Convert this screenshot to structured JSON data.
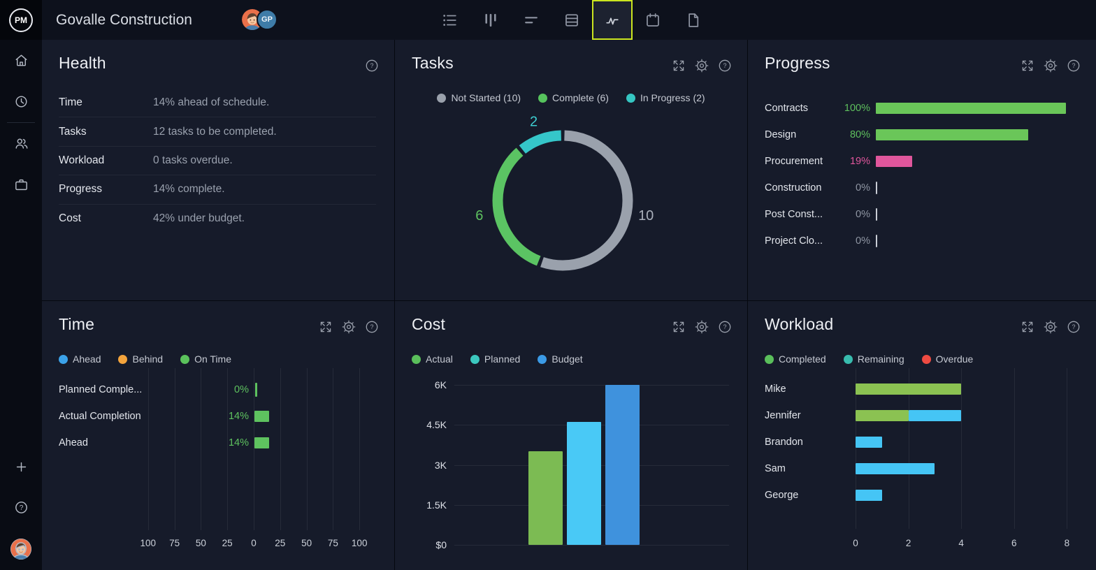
{
  "topbar": {
    "logo": "PM",
    "title": "Govalle Construction",
    "avatar_initials": "GP",
    "active_border_color": "#cbe51f",
    "tools": [
      {
        "name": "list-view",
        "icon": "list-icon",
        "active": false
      },
      {
        "name": "board-view",
        "icon": "board-columns-icon",
        "active": false
      },
      {
        "name": "gantt-view",
        "icon": "gantt-lines-icon",
        "active": false
      },
      {
        "name": "table-view",
        "icon": "table-icon",
        "active": false
      },
      {
        "name": "dashboard-view",
        "icon": "pulse-icon",
        "active": true
      },
      {
        "name": "calendar-view",
        "icon": "calendar-icon",
        "active": false
      },
      {
        "name": "docs-view",
        "icon": "document-icon",
        "active": false
      }
    ]
  },
  "sidebar": {
    "items": [
      "home",
      "recent",
      "team",
      "portfolio"
    ],
    "footer_items": [
      "add",
      "help",
      "profile"
    ]
  },
  "panels": {
    "health": {
      "title": "Health",
      "rows": [
        {
          "label": "Time",
          "value": "14% ahead of schedule."
        },
        {
          "label": "Tasks",
          "value": "12 tasks to be completed."
        },
        {
          "label": "Workload",
          "value": "0 tasks overdue."
        },
        {
          "label": "Progress",
          "value": "14% complete."
        },
        {
          "label": "Cost",
          "value": "42% under budget."
        }
      ]
    },
    "tasks": {
      "title": "Tasks",
      "legend": [
        {
          "label": "Not Started (10)",
          "color": "#9aa1ac"
        },
        {
          "label": "Complete (6)",
          "color": "#56c35d"
        },
        {
          "label": "In Progress (2)",
          "color": "#35c6c2"
        }
      ]
    },
    "progress": {
      "title": "Progress"
    },
    "time": {
      "title": "Time",
      "legend": [
        {
          "label": "Ahead",
          "color": "#3ba2e9"
        },
        {
          "label": "Behind",
          "color": "#f4a43c"
        },
        {
          "label": "On Time",
          "color": "#5bc25c"
        }
      ]
    },
    "cost": {
      "title": "Cost",
      "legend": [
        {
          "label": "Actual",
          "color": "#5abf5b"
        },
        {
          "label": "Planned",
          "color": "#3cc8bf"
        },
        {
          "label": "Budget",
          "color": "#3b9ae5"
        }
      ]
    },
    "workload": {
      "title": "Workload",
      "legend": [
        {
          "label": "Completed",
          "color": "#5abf5b"
        },
        {
          "label": "Remaining",
          "color": "#38bcae"
        },
        {
          "label": "Overdue",
          "color": "#ee4b42"
        }
      ]
    }
  },
  "chart_data": [
    {
      "id": "tasks-donut",
      "type": "donut",
      "title": "Tasks",
      "total": 18,
      "slices": [
        {
          "label": "Not Started",
          "count": 10,
          "color": "#9aa1ac",
          "label_color": "#aab0bb"
        },
        {
          "label": "Complete",
          "count": 6,
          "color": "#5bc463",
          "label_color": "#5ec25f"
        },
        {
          "label": "In Progress",
          "count": 2,
          "color": "#35c6c9",
          "label_color": "#3ecdd0"
        }
      ]
    },
    {
      "id": "progress-bars",
      "type": "bar",
      "title": "Progress",
      "categories": [
        "Contracts",
        "Design",
        "Procurement",
        "Construction",
        "Post Const...",
        "Project Clo..."
      ],
      "values": [
        100,
        80,
        19,
        0,
        0,
        0
      ],
      "value_labels": [
        "100%",
        "80%",
        "19%",
        "0%",
        "0%",
        "0%"
      ],
      "bar_colors": [
        "#6ac659",
        "#6ac659",
        "#e0569c",
        null,
        null,
        null
      ],
      "value_label_colors": [
        "#5ebf5d",
        "#5ebf5d",
        "#e0569c",
        "#8f96a3",
        "#8f96a3",
        "#8f96a3"
      ],
      "xmax": 100
    },
    {
      "id": "time-bars",
      "type": "bar-mirrored",
      "title": "Time",
      "categories": [
        "Planned Comple...",
        "Actual Completion",
        "Ahead"
      ],
      "values": [
        0,
        14,
        14
      ],
      "value_labels": [
        "0%",
        "14%",
        "14%"
      ],
      "bar_color": "#5ec25f",
      "axis_ticks": [
        "100",
        "75",
        "50",
        "25",
        "0",
        "25",
        "50",
        "75",
        "100"
      ],
      "units_per_tick": 25
    },
    {
      "id": "cost-columns",
      "type": "column",
      "title": "Cost",
      "categories": [
        "Actual",
        "Planned",
        "Budget"
      ],
      "values": [
        3500,
        4600,
        6000
      ],
      "bar_colors": [
        "#7cbb53",
        "#49c9f6",
        "#3f92dd"
      ],
      "y_ticks": [
        {
          "label": "6K",
          "value": 6000
        },
        {
          "label": "4.5K",
          "value": 4500
        },
        {
          "label": "3K",
          "value": 3000
        },
        {
          "label": "1.5K",
          "value": 1500
        },
        {
          "label": "$0",
          "value": 0
        }
      ],
      "ymax": 6000
    },
    {
      "id": "workload-bars",
      "type": "stacked-bar",
      "title": "Workload",
      "categories": [
        "Mike",
        "Jennifer",
        "Brandon",
        "Sam",
        "George"
      ],
      "series": [
        {
          "name": "Completed",
          "color": "#8bc252",
          "values": [
            4,
            2,
            0,
            0,
            0
          ]
        },
        {
          "name": "Remaining",
          "color": "#45c5f5",
          "values": [
            0,
            2,
            1,
            3,
            1
          ]
        }
      ],
      "x_ticks": [
        "0",
        "2",
        "4",
        "6",
        "8"
      ],
      "xmax": 8
    }
  ]
}
